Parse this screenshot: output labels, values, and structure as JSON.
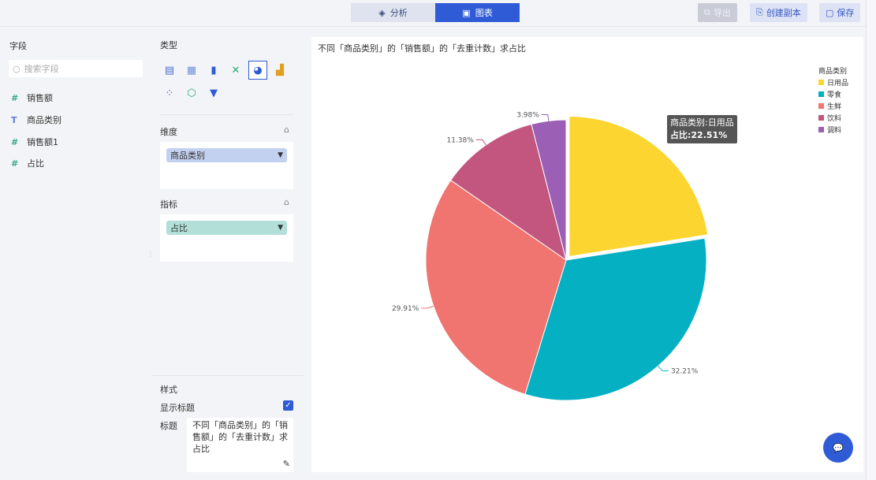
{
  "header": {
    "tabs": [
      {
        "label": "分析",
        "icon": "layers-icon"
      },
      {
        "label": "图表",
        "icon": "chart-screen-icon"
      }
    ],
    "export": "导出",
    "copy": "创建副本",
    "save": "保存"
  },
  "fields": {
    "title": "字段",
    "search_placeholder": "搜索字段",
    "items": [
      {
        "type": "#",
        "name": "销售额"
      },
      {
        "type": "T",
        "name": "商品类别"
      },
      {
        "type": "#",
        "name": "销售额1"
      },
      {
        "type": "#",
        "name": "占比"
      }
    ]
  },
  "config": {
    "type_title": "类型",
    "dimension_title": "维度",
    "dimension_value": "商品类别",
    "metric_title": "指标",
    "metric_value": "占比",
    "style_title": "样式",
    "show_title_label": "显示标题",
    "show_title_checked": true,
    "title_label": "标题",
    "title_value": "不同「商品类别」的「销售额」的「去重计数」求占比"
  },
  "chart_data": {
    "type": "pie",
    "title": "不同「商品类别」的「销售额」的「去重计数」求占比",
    "legend_title": "商品类别",
    "legend_position": "top-right",
    "categories": [
      "日用品",
      "零食",
      "生鲜",
      "饮料",
      "调料"
    ],
    "values": [
      22.51,
      32.21,
      29.91,
      11.38,
      3.98
    ],
    "labels": [
      "22.51%",
      "32.21%",
      "29.91%",
      "11.38%",
      "3.98%"
    ],
    "colors": [
      "#fdd531",
      "#05b0c3",
      "#f07470",
      "#c3567f",
      "#9b5fb5"
    ],
    "tooltip": {
      "line1": "商品类别:日用品",
      "line2": "占比:22.51%"
    }
  }
}
